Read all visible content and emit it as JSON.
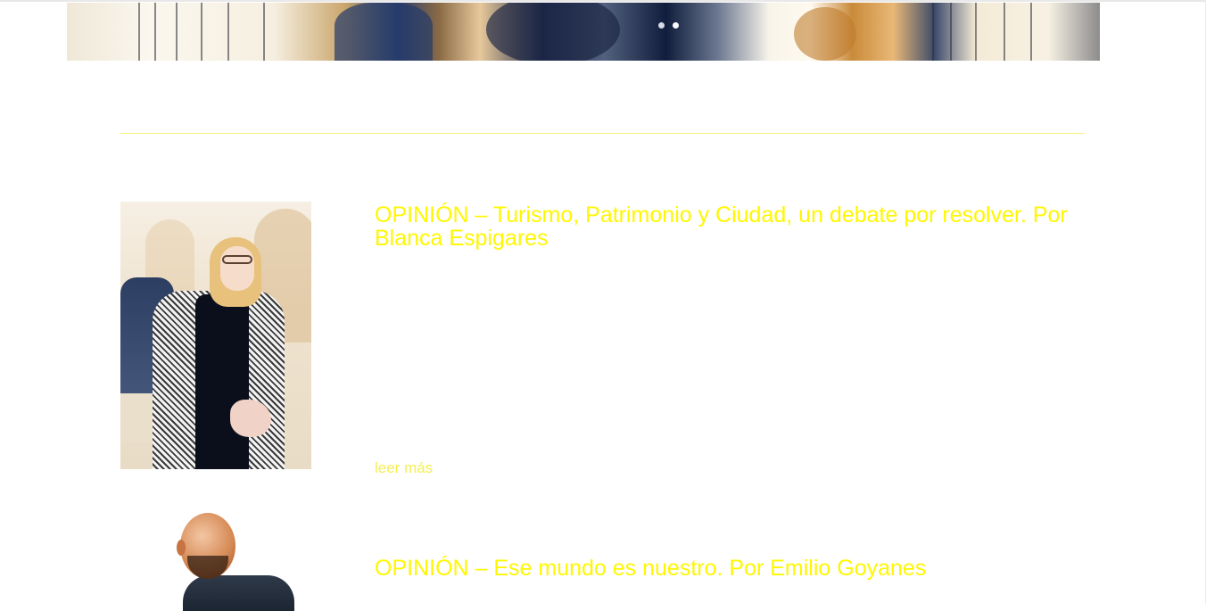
{
  "banner": {
    "slide_count": 2,
    "active_slide": 2
  },
  "posts": [
    {
      "title": "OPINIÓN – Turismo, Patrimonio y Ciudad, un debate por resolver. Por Blanca Espigares",
      "read_more": "leer más"
    },
    {
      "title": "OPINIÓN – Ese mundo es nuestro. Por Emilio Goyanes"
    }
  ],
  "colors": {
    "accent": "#fff700",
    "divider": "#f5f07a",
    "background": "#ffffff"
  }
}
